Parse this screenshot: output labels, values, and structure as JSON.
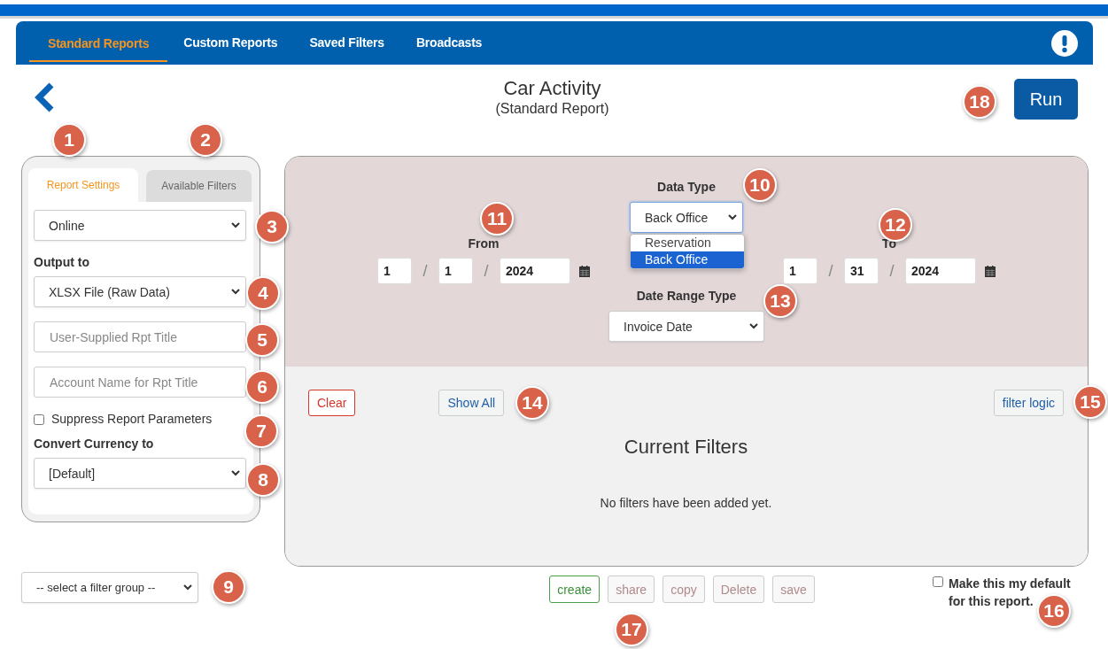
{
  "nav": {
    "tabs": [
      {
        "label": "Standard Reports",
        "selected": true
      },
      {
        "label": "Custom Reports",
        "selected": false
      },
      {
        "label": "Saved Filters",
        "selected": false
      },
      {
        "label": "Broadcasts",
        "selected": false
      }
    ]
  },
  "header": {
    "title": "Car Activity",
    "subtitle": "(Standard Report)",
    "run_button": "Run"
  },
  "settings_panel": {
    "tabs": [
      {
        "label": "Report Settings",
        "selected": true
      },
      {
        "label": "Available Filters",
        "selected": false
      }
    ],
    "mode_select": "Online",
    "output_label": "Output to",
    "output_select": "XLSX File (Raw Data)",
    "title_field": {
      "placeholder": "User-Supplied Rpt Title"
    },
    "account_field": {
      "placeholder": "Account Name for Rpt Title"
    },
    "suppress": {
      "label": "Suppress Report Parameters",
      "checked": false
    },
    "currency_label": "Convert Currency to",
    "currency_select": "[Default]"
  },
  "filter_group_select": "-- select a filter group --",
  "date_panel": {
    "data_type": {
      "label": "Data Type",
      "value": "Back Office",
      "expanded": true,
      "options": [
        {
          "label": "Reservation",
          "selected": false
        },
        {
          "label": "Back Office",
          "selected": true
        }
      ]
    },
    "from": {
      "label": "From",
      "month": "1",
      "day": "1",
      "year": "2024"
    },
    "to": {
      "label": "To",
      "month": "1",
      "day": "31",
      "year": "2024"
    },
    "separator": "/",
    "date_range_type": {
      "label": "Date Range Type",
      "value": "Invoice Date"
    }
  },
  "filters": {
    "clear_button": "Clear",
    "show_all_button": "Show All",
    "filter_logic_button": "filter logic",
    "title": "Current Filters",
    "empty_message": "No filters have been added yet."
  },
  "actions": [
    {
      "label": "create",
      "disabled": false
    },
    {
      "label": "share",
      "disabled": true
    },
    {
      "label": "copy",
      "disabled": true
    },
    {
      "label": "Delete",
      "disabled": true
    },
    {
      "label": "save",
      "disabled": true
    }
  ],
  "default_checkbox": {
    "label": "Make this my default for this report.",
    "checked": false
  },
  "callouts": [
    "1",
    "2",
    "3",
    "4",
    "5",
    "6",
    "7",
    "8",
    "9",
    "10",
    "11",
    "12",
    "13",
    "14",
    "15",
    "16",
    "17",
    "18"
  ]
}
